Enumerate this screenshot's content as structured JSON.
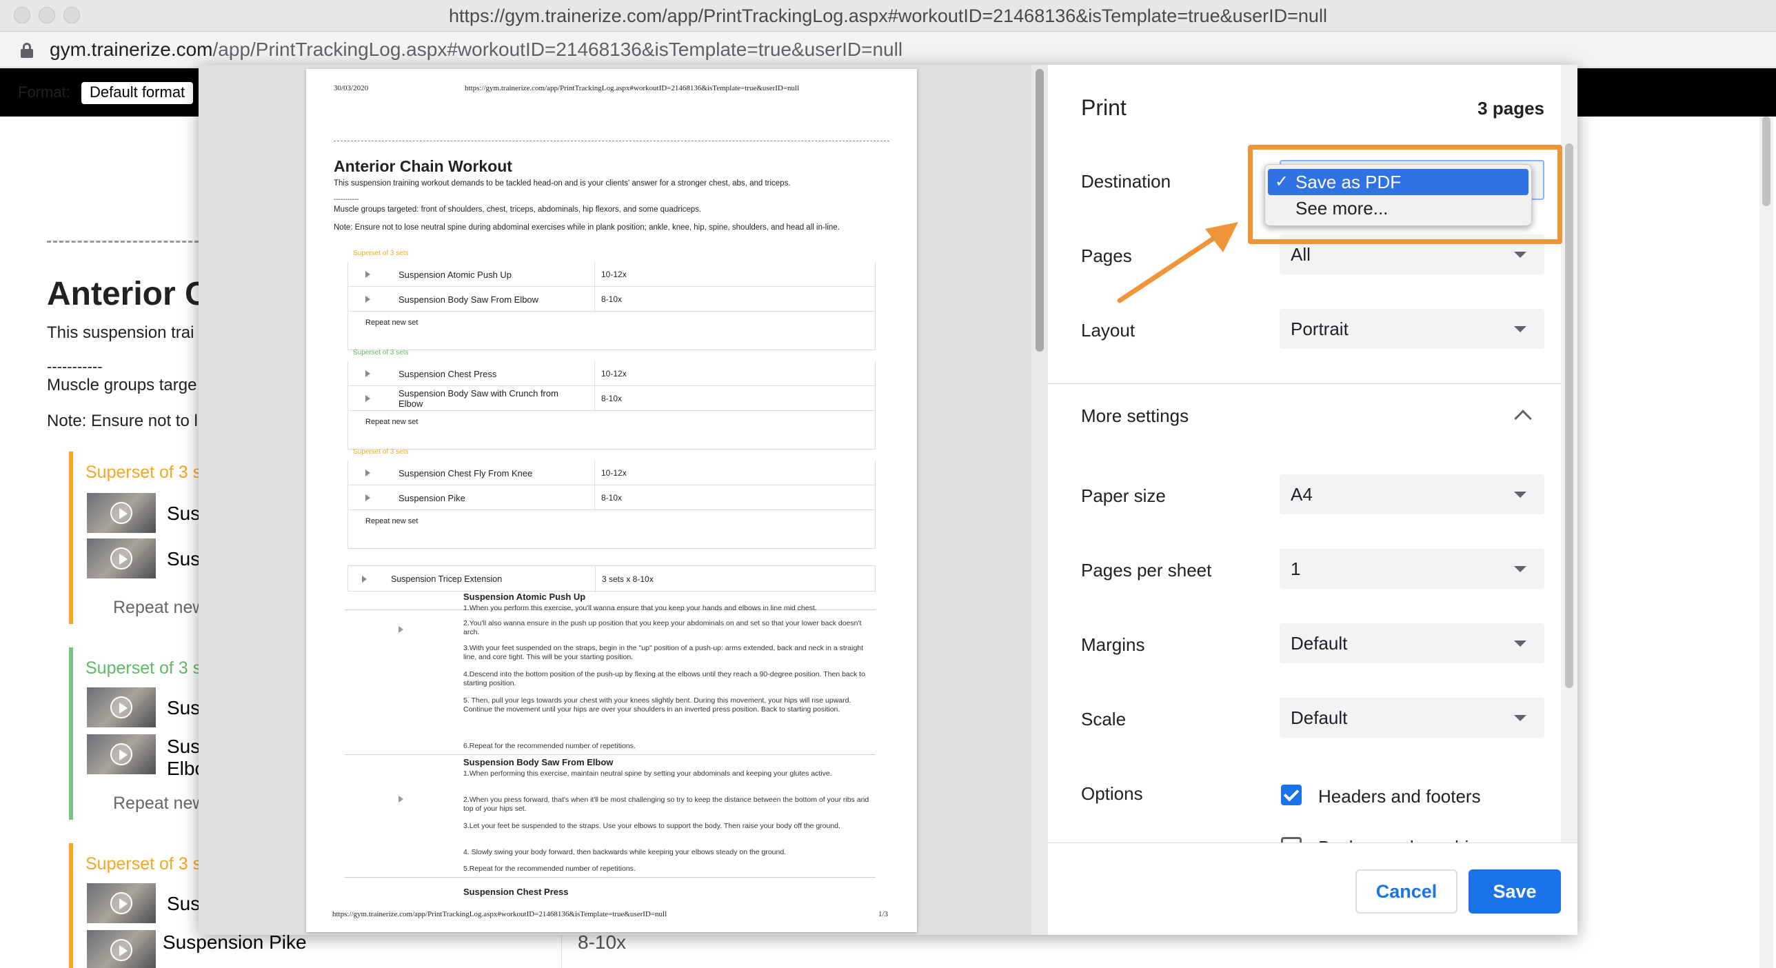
{
  "window": {
    "title": "https://gym.trainerize.com/app/PrintTrackingLog.aspx#workoutID=21468136&isTemplate=true&userID=null",
    "url_host": "gym.trainerize.com",
    "url_path": "/app/PrintTrackingLog.aspx#workoutID=21468136&isTemplate=true&userID=null"
  },
  "page": {
    "format_label": "Format:",
    "format_value": "Default format",
    "title": "Anterior C",
    "description": "This suspension trai",
    "dashes": "-----------",
    "muscle": "Muscle groups targe",
    "note": "Note: Ensure not to l",
    "supersets": [
      {
        "label": "Superset of 3 se",
        "items": [
          "Susp",
          "Susp"
        ],
        "repeat": "Repeat new"
      },
      {
        "label": "Superset of 3 se",
        "items": [
          "Susp",
          "Susp Elbo"
        ],
        "repeat": "Repeat new"
      },
      {
        "label": "Superset of 3 se",
        "items": [
          "Susp"
        ]
      }
    ],
    "last_exercise": "Suspension Pike",
    "last_reps": "8-10x"
  },
  "preview": {
    "date": "30/03/2020",
    "header_url": "https://gym.trainerize.com/app/PrintTrackingLog.aspx#workoutID=21468136&isTemplate=true&userID=null",
    "title": "Anterior Chain Workout",
    "description": "This suspension training workout demands to be tackled head-on and is your clients' answer for a stronger chest, abs, and triceps.",
    "short_dash": "-----------",
    "muscle_groups": "Muscle groups targeted: front of shoulders, chest, triceps, abdominals, hip flexors, and some quadriceps.",
    "note": "Note: Ensure not to lose neutral spine during abdominal exercises while in plank position; ankle, knee, hip, spine, shoulders, and head all in-line.",
    "supersets": [
      {
        "label": "Superset of 3 sets",
        "color": "#f5a623",
        "rows": [
          {
            "name": "Suspension Atomic Push Up",
            "reps": "10-12x"
          },
          {
            "name": "Suspension Body Saw From Elbow",
            "reps": "8-10x"
          }
        ],
        "repeat": "Repeat new set"
      },
      {
        "label": "Superset of 3 sets",
        "color": "#5fba64",
        "rows": [
          {
            "name": "Suspension Chest Press",
            "reps": "10-12x"
          },
          {
            "name": "Suspension Body Saw with Crunch from Elbow",
            "reps": "8-10x"
          }
        ],
        "repeat": "Repeat new set"
      },
      {
        "label": "Superset of 3 sets",
        "color": "#f5a623",
        "rows": [
          {
            "name": "Suspension Chest Fly From Knee",
            "reps": "10-12x"
          },
          {
            "name": "Suspension Pike",
            "reps": "8-10x"
          }
        ],
        "repeat": "Repeat new set"
      }
    ],
    "single": {
      "name": "Suspension Tricep Extension",
      "reps": "3 sets x 8-10x"
    },
    "exercises": [
      {
        "name": "Suspension Atomic Push Up",
        "steps": [
          "1.When you perform this exercise, you'll wanna ensure that you keep your hands and elbows in line mid chest.",
          "2.You'll also wanna ensure in the push up position that you keep your abdominals on and set so that your lower back doesn't arch.",
          "3.With your feet suspended on the straps, begin in the \"up\" position of a push-up: arms extended, back and neck in a straight line, and core tight. This will be your starting position.",
          "4.Descend into the bottom position of the push-up by flexing at the elbows until they reach a 90-degree position. Then back to starting position.",
          "5. Then, pull your legs towards your chest with your knees slightly bent. During this movement, your hips will rise upward. Continue the movement until your hips are over your shoulders in an inverted press position. Back to starting position.",
          "6.Repeat for the recommended number of repetitions."
        ]
      },
      {
        "name": "Suspension Body Saw From Elbow",
        "steps": [
          "1.When performing this exercise, maintain neutral spine by setting your abdominals and keeping your glutes active.",
          "2.When you press forward, that's when it'll be most challenging so try to keep the distance between the bottom of your ribs and top of your hips set.",
          "3.Let your feet be suspended to the straps. Use your elbows to support the body. Then raise your body off the ground.",
          "4. Slowly swing your body forward, then backwards while keeping your elbows steady on the ground.",
          "5.Repeat for the recommended number of repetitions."
        ]
      },
      {
        "name": "Suspension Chest Press",
        "steps": []
      }
    ],
    "footer_url": "https://gym.trainerize.com/app/PrintTrackingLog.aspx#workoutID=21468136&isTemplate=true&userID=null",
    "page_num": "1/3"
  },
  "settings": {
    "title": "Print",
    "page_count": "3 pages",
    "destination_label": "Destination",
    "destination_options": [
      {
        "label": "Save as PDF",
        "checked": "✓"
      },
      {
        "label": "See more..."
      }
    ],
    "pages_label": "Pages",
    "pages_value": "All",
    "layout_label": "Layout",
    "layout_value": "Portrait",
    "more_settings_label": "More settings",
    "paper_size_label": "Paper size",
    "paper_size_value": "A4",
    "pps_label": "Pages per sheet",
    "pps_value": "1",
    "margins_label": "Margins",
    "margins_value": "Default",
    "scale_label": "Scale",
    "scale_value": "Default",
    "options_label": "Options",
    "headers_footers_label": "Headers and footers",
    "headers_footers_checked": true,
    "background_graphics_label": "Background graphics",
    "cancel_label": "Cancel",
    "save_label": "Save"
  },
  "colors": {
    "accent": "#1a73e8",
    "annotation": "#f0943a",
    "superset_orange": "#f5a623",
    "superset_green": "#5fba64"
  }
}
